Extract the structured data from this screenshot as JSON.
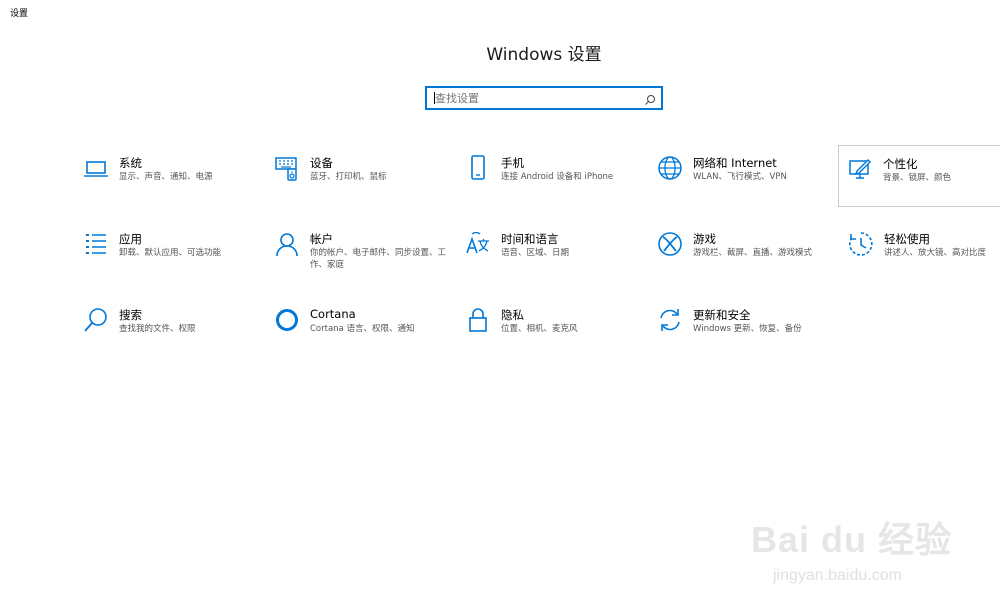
{
  "window": {
    "title": "设置"
  },
  "header": {
    "title": "Windows 设置"
  },
  "search": {
    "placeholder": "查找设置",
    "icon": "search-icon"
  },
  "accent_color": "#0078d7",
  "tiles": [
    {
      "title": "系统",
      "desc": "显示、声音、通知、电源",
      "icon": "laptop-icon"
    },
    {
      "title": "设备",
      "desc": "蓝牙、打印机、鼠标",
      "icon": "devices-icon"
    },
    {
      "title": "手机",
      "desc": "连接 Android 设备和 iPhone",
      "icon": "phone-icon"
    },
    {
      "title": "网络和 Internet",
      "desc": "WLAN、飞行模式、VPN",
      "icon": "globe-icon"
    },
    {
      "title": "个性化",
      "desc": "背景、锁屏、颜色",
      "icon": "personalization-icon"
    },
    {
      "title": "应用",
      "desc": "卸载、默认应用、可选功能",
      "icon": "apps-list-icon"
    },
    {
      "title": "帐户",
      "desc": "你的帐户、电子邮件、同步设置、工作、家庭",
      "icon": "person-icon"
    },
    {
      "title": "时间和语言",
      "desc": "语音、区域、日期",
      "icon": "time-language-icon"
    },
    {
      "title": "游戏",
      "desc": "游戏栏、截屏、直播、游戏模式",
      "icon": "xbox-icon"
    },
    {
      "title": "轻松使用",
      "desc": "讲述人、放大镜、高对比度",
      "icon": "ease-of-access-icon"
    },
    {
      "title": "搜索",
      "desc": "查找我的文件、权限",
      "icon": "search-icon"
    },
    {
      "title": "Cortana",
      "desc": "Cortana 语言、权限、通知",
      "icon": "cortana-icon"
    },
    {
      "title": "隐私",
      "desc": "位置、相机、麦克风",
      "icon": "lock-icon"
    },
    {
      "title": "更新和安全",
      "desc": "Windows 更新、恢复、备份",
      "icon": "update-icon"
    }
  ],
  "watermark": {
    "brand": "Bai du 经验",
    "url": "jingyan.baidu.com"
  }
}
